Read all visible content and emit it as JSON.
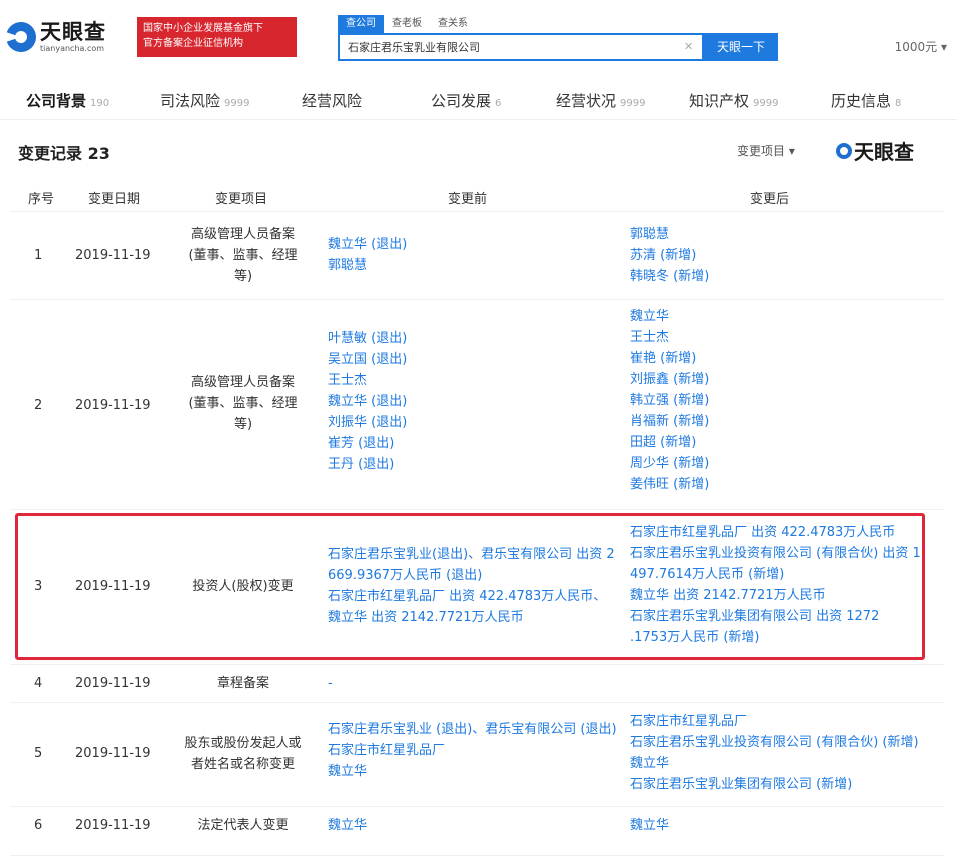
{
  "header": {
    "logo_name": "天眼查",
    "logo_url": "tianyancha.com",
    "banner_line1": "国家中小企业发展基金旗下",
    "banner_line2": "官方备案企业征信机构",
    "search_tabs": [
      "查公司",
      "查老板",
      "查关系"
    ],
    "search_value": "石家庄君乐宝乳业有限公司",
    "search_button": "天眼一下",
    "user": "1000元"
  },
  "nav": [
    {
      "label": "公司背景",
      "count": "190"
    },
    {
      "label": "司法风险",
      "count": "9999"
    },
    {
      "label": "经营风险",
      "count": ""
    },
    {
      "label": "公司发展",
      "count": "6"
    },
    {
      "label": "经营状况",
      "count": "9999"
    },
    {
      "label": "知识产权",
      "count": "9999"
    },
    {
      "label": "历史信息",
      "count": "8"
    }
  ],
  "section": {
    "title": "变更记录 23",
    "filter_label": "变更项目",
    "watermark": "天眼查"
  },
  "table": {
    "headers": [
      "序号",
      "变更日期",
      "变更项目",
      "变更前",
      "变更后"
    ],
    "rows": [
      {
        "num": "1",
        "date": "2019-11-19",
        "item": [
          "高级管理人员备案",
          "(董事、监事、经理",
          "等)"
        ],
        "before": [
          "魏立华 (退出)",
          "郭聪慧"
        ],
        "after": [
          "郭聪慧",
          "苏清 (新增)",
          "韩晓冬 (新增)"
        ]
      },
      {
        "num": "2",
        "date": "2019-11-19",
        "item": [
          "高级管理人员备案",
          "(董事、监事、经理",
          "等)"
        ],
        "before": [
          "叶慧敏 (退出)",
          "吴立国 (退出)",
          "王士杰",
          "魏立华 (退出)",
          "刘振华 (退出)",
          "崔芳 (退出)",
          "王丹 (退出)"
        ],
        "after": [
          "魏立华",
          "王士杰",
          "崔艳 (新增)",
          "刘振鑫 (新增)",
          "韩立强 (新增)",
          "肖福新 (新增)",
          "田超 (新增)",
          "周少华 (新增)",
          "姜伟旺 (新增)"
        ]
      },
      {
        "num": "3",
        "date": "2019-11-19",
        "item": [
          "投资人(股权)变更"
        ],
        "before": [
          "石家庄君乐宝乳业(退出)、君乐宝有限公司 出资 2",
          "669.9367万人民币 (退出)",
          "石家庄市红星乳品厂 出资 422.4783万人民币、",
          "魏立华 出资 2142.7721万人民币"
        ],
        "after": [
          "石家庄市红星乳品厂 出资 422.4783万人民币",
          "石家庄君乐宝乳业投资有限公司 (有限合伙) 出资 1",
          "497.7614万人民币 (新增)",
          "魏立华 出资 2142.7721万人民币",
          "石家庄君乐宝乳业集团有限公司 出资 1272",
          ".1753万人民币 (新增)"
        ]
      },
      {
        "num": "4",
        "date": "2019-11-19",
        "item": [
          "章程备案"
        ],
        "before": [
          "-"
        ],
        "after": [
          ""
        ]
      },
      {
        "num": "5",
        "date": "2019-11-19",
        "item": [
          "股东或股份发起人或",
          "者姓名或名称变更"
        ],
        "before": [
          "石家庄君乐宝乳业 (退出)、君乐宝有限公司 (退出)",
          "石家庄市红星乳品厂",
          "魏立华"
        ],
        "after": [
          "石家庄市红星乳品厂",
          "石家庄君乐宝乳业投资有限公司 (有限合伙) (新增)",
          "魏立华",
          "石家庄君乐宝乳业集团有限公司 (新增)"
        ]
      },
      {
        "num": "6",
        "date": "2019-11-19",
        "item": [
          "法定代表人变更"
        ],
        "before": [
          "魏立华"
        ],
        "after": [
          "魏立华"
        ]
      }
    ]
  }
}
